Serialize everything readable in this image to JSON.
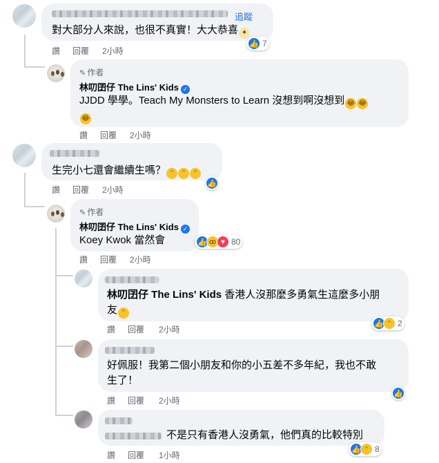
{
  "c1": {
    "follow": "追蹤",
    "text": "對大部分人來說，也很不真實！大大恭喜",
    "emoji": "confetti-emoji",
    "actions": {
      "like": "讚",
      "reply": "回覆",
      "time": "2小時"
    },
    "reaction_count": "7"
  },
  "r1": {
    "author_label": "作者",
    "name": "林叨囝仔 The Lins' Kids",
    "text": "JJDD 學學。Teach My Monsters to Learn 沒想到啊沒想到",
    "actions": {
      "like": "讚",
      "reply": "回覆",
      "time": "2小時"
    }
  },
  "c2": {
    "text": "生完小七還會繼續生嗎？",
    "actions": {
      "like": "讚",
      "reply": "回覆",
      "time": "2小時"
    }
  },
  "r2": {
    "author_label": "作者",
    "name": "林叨囝仔 The Lins' Kids",
    "text": "Koey Kwok 當然會",
    "actions": {
      "like": "讚",
      "reply": "回覆",
      "time": "2小時"
    },
    "reaction_count": "80"
  },
  "r3": {
    "mention": "林叨囝仔 The Lins' Kids",
    "text_line1": "香港人沒那麼多勇氣生這麼多小朋",
    "text_line2": "友",
    "actions": {
      "like": "讚",
      "reply": "回覆",
      "time": "2小時"
    },
    "reaction_count": "2"
  },
  "r4": {
    "text_line1": "好佩服！我第二個小朋友和你的小五差不多年紀，我也不敢",
    "text_line2": "生了！",
    "actions": {
      "like": "讚",
      "reply": "回覆",
      "time": "2小時"
    }
  },
  "r5": {
    "text": "不是只有香港人沒勇氣，他們真的比較特別",
    "actions": {
      "like": "讚",
      "reply": "回覆",
      "time": "1小時"
    },
    "reaction_count": "8"
  },
  "colors": {
    "bubble": "#f0f2f5",
    "link": "#216fdb",
    "like": "#1877f2",
    "meta": "#65676b"
  }
}
